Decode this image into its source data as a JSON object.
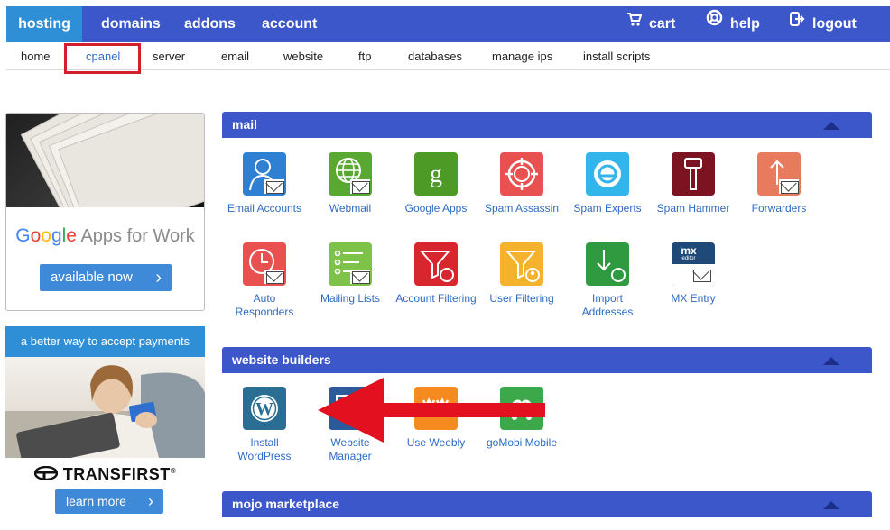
{
  "topnav": {
    "left": [
      {
        "label": "hosting",
        "active": true
      },
      {
        "label": "domains"
      },
      {
        "label": "addons"
      },
      {
        "label": "account"
      }
    ],
    "right": [
      {
        "label": "cart",
        "icon": "cart-icon"
      },
      {
        "label": "help",
        "icon": "lifebuoy-icon"
      },
      {
        "label": "logout",
        "icon": "logout-icon"
      }
    ]
  },
  "subnav": {
    "items": [
      {
        "label": "home"
      },
      {
        "label": "cpanel",
        "active": true
      },
      {
        "label": "server"
      },
      {
        "label": "email"
      },
      {
        "label": "website"
      },
      {
        "label": "ftp"
      },
      {
        "label": "databases"
      },
      {
        "label": "manage ips"
      },
      {
        "label": "install scripts"
      }
    ]
  },
  "ads": {
    "google": {
      "brand": "Google",
      "tagline": " Apps for Work",
      "button": "available now",
      "chevron": "›",
      "brand_colors": [
        "#4285f4",
        "#ea4335",
        "#fbbc05",
        "#4285f4",
        "#34a853",
        "#ea4335"
      ]
    },
    "payments": {
      "header": "a better way to accept payments",
      "brand": "TRANSFIRST",
      "brand_mark": "®",
      "button": "learn more",
      "chevron": "›"
    }
  },
  "sections": {
    "mail": {
      "title": "mail",
      "apps": [
        {
          "label": "Email Accounts",
          "icon": "user-mail-icon",
          "color": "#2f7fd2"
        },
        {
          "label": "Webmail",
          "icon": "globe-mail-icon",
          "color": "#59a832"
        },
        {
          "label": "Google Apps",
          "icon": "google-g-icon",
          "color": "#4e9a26"
        },
        {
          "label": "Spam Assassin",
          "icon": "crosshair-icon",
          "color": "#e8514f"
        },
        {
          "label": "Spam Experts",
          "icon": "spam-experts-icon",
          "color": "#32b5ea"
        },
        {
          "label": "Spam Hammer",
          "icon": "hammer-icon",
          "color": "#7b1420"
        },
        {
          "label": "Forwarders",
          "icon": "forward-mail-icon",
          "color": "#e87a5d"
        },
        {
          "label": "Auto Responders",
          "icon": "clock-mail-icon",
          "color": "#e8514f"
        },
        {
          "label": "Mailing Lists",
          "icon": "list-mail-icon",
          "color": "#7fc24a"
        },
        {
          "label": "Account Filtering",
          "icon": "filter-icon",
          "color": "#d8262f"
        },
        {
          "label": "User Filtering",
          "icon": "user-filter-icon",
          "color": "#f5b32d"
        },
        {
          "label": "Import Addresses",
          "icon": "import-icon",
          "color": "#2f9a3f"
        },
        {
          "label": "MX Entry",
          "icon": "mx-entry-icon",
          "color": "#1f4a78",
          "mx": "mx",
          "mx_sub": "editor"
        }
      ]
    },
    "builders": {
      "title": "website builders",
      "apps": [
        {
          "label": "Install WordPress",
          "icon": "wordpress-icon",
          "color": "#2a6f93"
        },
        {
          "label": "Website Manager",
          "icon": "website-manager-icon",
          "color": "#2b5b9a"
        },
        {
          "label": "Use Weebly",
          "icon": "weebly-icon",
          "color": "#f58b1f"
        },
        {
          "label": "goMobi Mobile",
          "icon": "gomobi-icon",
          "color": "#3ca84a"
        }
      ]
    },
    "marketplace": {
      "title": "mojo marketplace"
    }
  },
  "colors": {
    "nav_blue": "#3c57c9",
    "active_tab": "#2f8fd6",
    "link": "#2e6bc4",
    "highlight_red": "#d21f2c",
    "arrow_red": "#e3111f"
  }
}
